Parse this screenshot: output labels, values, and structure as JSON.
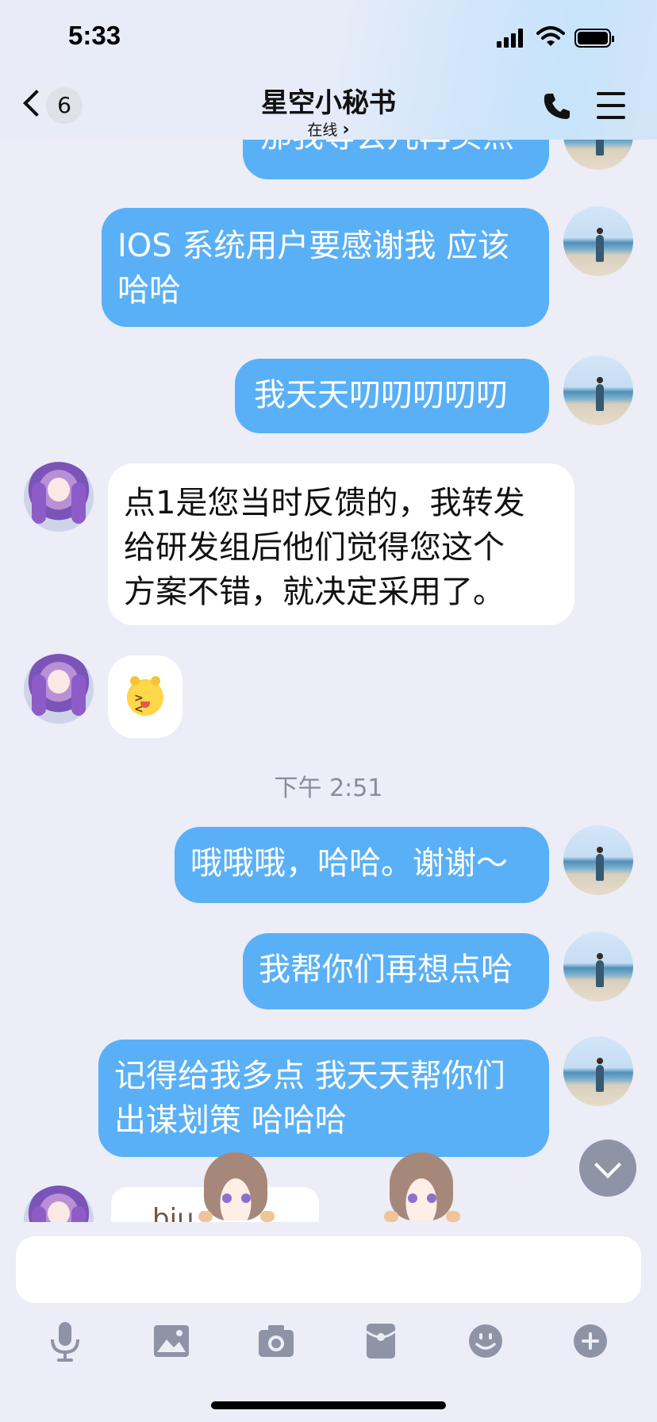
{
  "status_bar": {
    "time": "5:33"
  },
  "header": {
    "unread_count": "6",
    "title": "星空小秘书",
    "subtitle": "在线",
    "subtitle_chevron": "›"
  },
  "messages": [
    {
      "from": "me",
      "text": "那我等会儿再买点",
      "partial": true
    },
    {
      "from": "me",
      "text": "IOS 系统用户要感谢我 应该哈哈"
    },
    {
      "from": "me",
      "text": "我天天叨叨叨叨叨"
    },
    {
      "from": "bot",
      "text": "点1是您当时反馈的，我转发给研发组后他们觉得您这个方案不错，就决定采用了。"
    },
    {
      "from": "bot",
      "emoji": "laughing-face"
    },
    {
      "separator": "下午 2:51"
    },
    {
      "from": "me",
      "text": "哦哦哦，哈哈。谢谢～"
    },
    {
      "from": "me",
      "text": "我帮你们再想点哈"
    },
    {
      "from": "me",
      "text": "记得给我多点 我天天帮你们出谋划策 哈哈哈"
    },
    {
      "from": "bot",
      "sticker_text": "biu"
    }
  ],
  "lines": {
    "m0": "那我等会儿再买点",
    "m1a": "IOS 系统用户要感谢我 应该",
    "m1b": "哈哈",
    "m2": "我天天叨叨叨叨叨",
    "b1a": "点1是您当时反馈的，我转发",
    "b1b": "给研发组后他们觉得您这个",
    "b1c": "方案不错，就决定采用了。",
    "sep": "下午 2:51",
    "m3": "哦哦哦，哈哈。谢谢～",
    "m4": "我帮你们再想点哈",
    "m5a": "记得给我多点 我天天帮你们",
    "m5b": "出谋划策 哈哈哈",
    "sticker": "biu"
  },
  "input": {
    "value": "",
    "placeholder": ""
  },
  "toolbar": {
    "icons": [
      "microphone-icon",
      "image-icon",
      "camera-icon",
      "red-packet-icon",
      "emoji-icon",
      "plus-icon"
    ]
  },
  "colors": {
    "my_bubble": "#5ab0f6",
    "bot_bubble": "#ffffff",
    "background": "#ecedf6",
    "toolbar_icon": "#8e93a5"
  }
}
